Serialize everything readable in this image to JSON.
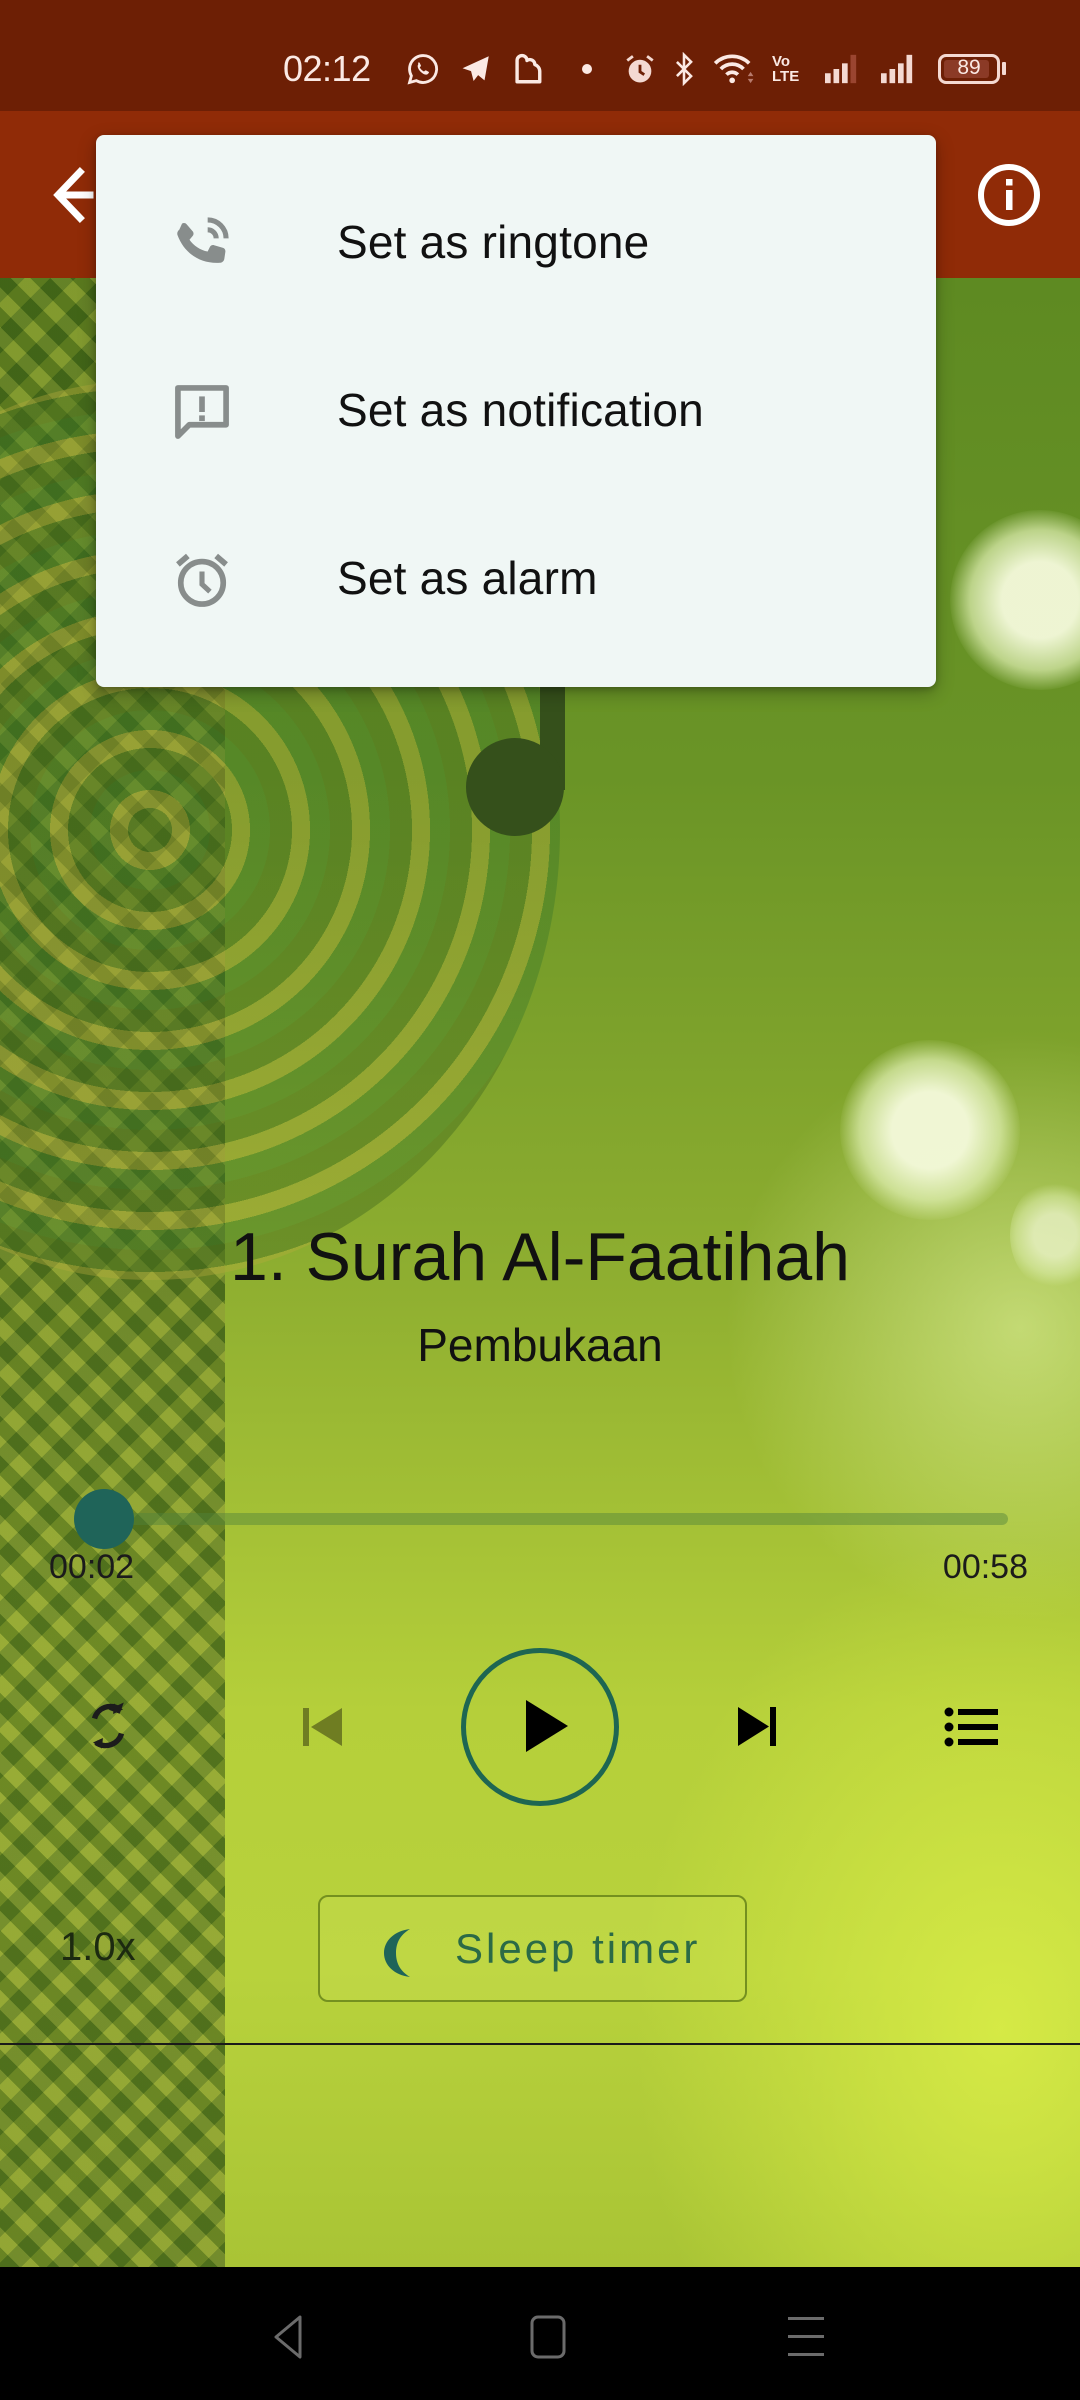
{
  "status_bar": {
    "time": "02:12",
    "notification_icons": [
      "whatsapp-icon",
      "telegram-icon",
      "cloud-app-icon",
      "dot-indicator"
    ],
    "system_icons": [
      "alarm-icon",
      "bluetooth-icon",
      "wifi-icon",
      "volte-lte-icon",
      "signal-sim1-icon",
      "signal-sim2-icon"
    ],
    "battery_level": "89",
    "battery_fraction": 0.89
  },
  "app_bar": {
    "back_icon": "arrow-back-icon",
    "info_icon": "info-icon",
    "color": "#902b07"
  },
  "popup_menu": {
    "items": [
      {
        "icon": "ringtone-phone-icon",
        "label": "Set as ringtone"
      },
      {
        "icon": "notification-alert-icon",
        "label": "Set as notification"
      },
      {
        "icon": "alarm-clock-icon",
        "label": "Set as alarm"
      }
    ]
  },
  "player": {
    "artwork_icon": "music-note-icon",
    "title": "1. Surah Al-Faatihah",
    "subtitle": "Pembukaan",
    "elapsed": "00:02",
    "total": "00:58",
    "progress_fraction": 0.0,
    "accent_color": "#1e6652",
    "controls": {
      "repeat_icon": "repeat-icon",
      "previous_icon": "skip-previous-icon",
      "previous_enabled": false,
      "play_icon": "play-icon",
      "next_icon": "skip-next-icon",
      "playlist_icon": "playlist-icon"
    },
    "speed": "1.0x",
    "sleep_timer": {
      "icon": "moon-icon",
      "label": "Sleep timer"
    }
  },
  "nav_bar": {
    "buttons": [
      "back-triangle-icon",
      "home-square-icon",
      "recents-menu-icon"
    ]
  }
}
